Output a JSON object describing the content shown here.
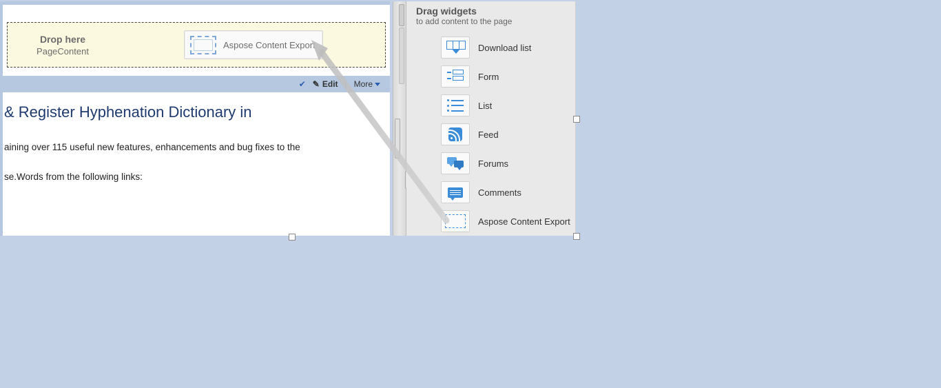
{
  "drop": {
    "title": "Drop here",
    "subtitle": "PageContent",
    "widget_label": "Aspose Content Export"
  },
  "toolbar": {
    "edit_label": "Edit",
    "more_label": "More"
  },
  "article": {
    "title": " & Register Hyphenation Dictionary in",
    "line1": "aining over 115 useful new features, enhancements and bug fixes to the",
    "line2": "se.Words from the following links:"
  },
  "widget_panel": {
    "title": "Drag widgets",
    "subtitle": "to add content to the page",
    "items": [
      {
        "label": "Download list",
        "icon": "download"
      },
      {
        "label": "Form",
        "icon": "form"
      },
      {
        "label": "List",
        "icon": "list"
      },
      {
        "label": "Feed",
        "icon": "feed"
      },
      {
        "label": "Forums",
        "icon": "forums"
      },
      {
        "label": "Comments",
        "icon": "comments"
      },
      {
        "label": "Aspose Content Export",
        "icon": "aspose"
      }
    ]
  }
}
